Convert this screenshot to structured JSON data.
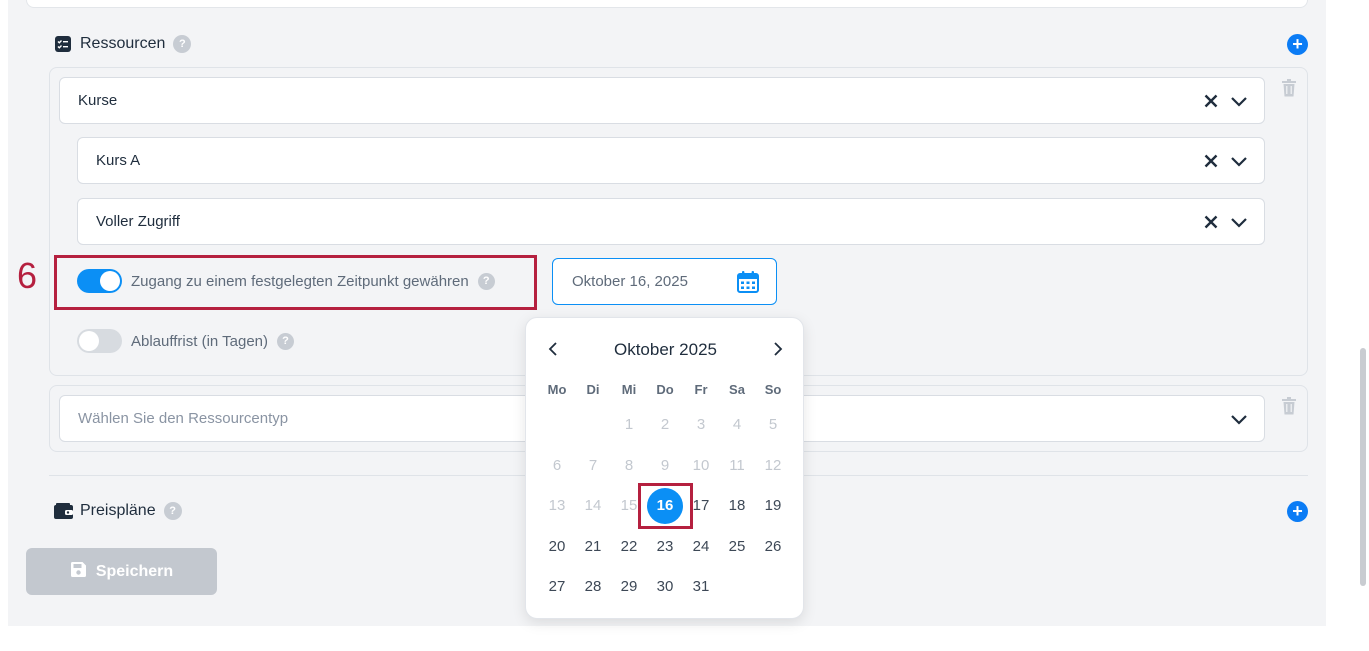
{
  "resources": {
    "title": "Ressourcen",
    "help": "?",
    "add": "+",
    "group1": {
      "type_select": "Kurse",
      "course_select": "Kurs A",
      "access_select": "Voller Zugriff",
      "fixed_time_toggle": {
        "label": "Zugang zu einem festgelegten Zeitpunkt gewähren",
        "on": true
      },
      "date_value": "Oktober 16, 2025",
      "expiry_toggle": {
        "label": "Ablauffrist (in Tagen)",
        "on": false
      }
    },
    "group2": {
      "type_placeholder": "Wählen Sie den Ressourcentyp"
    }
  },
  "pricing": {
    "title": "Preispläne",
    "help": "?",
    "add": "+"
  },
  "save_label": "Speichern",
  "step_marker": "6",
  "calendar": {
    "month_label": "Oktober 2025",
    "weekdays": [
      "Mo",
      "Di",
      "Mi",
      "Do",
      "Fr",
      "Sa",
      "So"
    ],
    "selected_day": "16",
    "weeks": [
      [
        "",
        "",
        "1",
        "2",
        "3",
        "4",
        "5"
      ],
      [
        "6",
        "7",
        "8",
        "9",
        "10",
        "11",
        "12"
      ],
      [
        "13",
        "14",
        "15",
        "16",
        "17",
        "18",
        "19"
      ],
      [
        "20",
        "21",
        "22",
        "23",
        "24",
        "25",
        "26"
      ],
      [
        "27",
        "28",
        "29",
        "30",
        "31",
        "",
        ""
      ]
    ],
    "disabled_through": 15
  },
  "colors": {
    "accent": "#0b8ff5",
    "highlight": "#b5203f",
    "disabled_button": "#c3c8cf"
  }
}
